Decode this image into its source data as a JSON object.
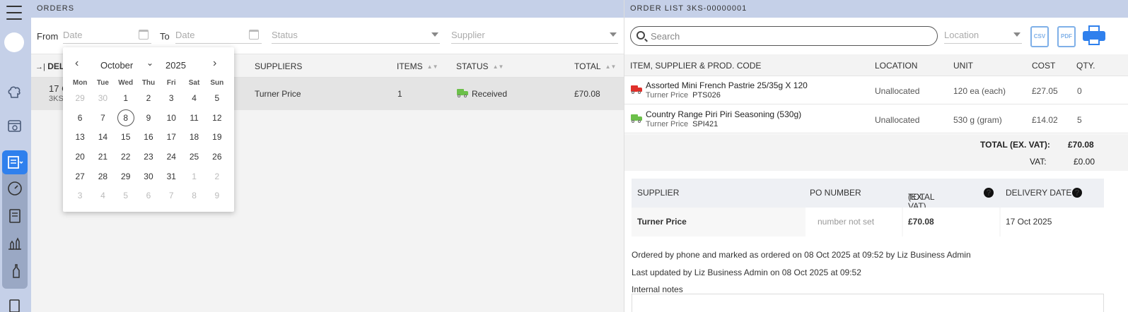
{
  "orders": {
    "title": "ORDERS",
    "filters": {
      "from_label": "From",
      "from_placeholder": "Date",
      "to_label": "To",
      "to_placeholder": "Date",
      "status_placeholder": "Status",
      "supplier_placeholder": "Supplier"
    },
    "columns": {
      "delivery": "DEL",
      "suppliers": "SUPPLIERS",
      "items": "ITEMS",
      "status": "STATUS",
      "total": "TOTAL"
    },
    "rows": [
      {
        "date": "17 C",
        "code": "3KS",
        "supplier": "Turner Price",
        "items": "1",
        "status": "Received",
        "total": "£70.08",
        "status_color": "#6cc04a"
      }
    ]
  },
  "calendar": {
    "month": "October",
    "year": "2025",
    "weekdays": [
      "Mon",
      "Tue",
      "Wed",
      "Thu",
      "Fri",
      "Sat",
      "Sun"
    ],
    "weeks": [
      [
        "29",
        "30",
        "1",
        "2",
        "3",
        "4",
        "5"
      ],
      [
        "6",
        "7",
        "8",
        "9",
        "10",
        "11",
        "12"
      ],
      [
        "13",
        "14",
        "15",
        "16",
        "17",
        "18",
        "19"
      ],
      [
        "20",
        "21",
        "22",
        "23",
        "24",
        "25",
        "26"
      ],
      [
        "27",
        "28",
        "29",
        "30",
        "31",
        "1",
        "2"
      ],
      [
        "3",
        "4",
        "5",
        "6",
        "7",
        "8",
        "9"
      ]
    ],
    "today": "8"
  },
  "detail": {
    "title": "ORDER LIST 3KS-00000001",
    "search_placeholder": "Search",
    "location_placeholder": "Location",
    "csv_label": "CSV",
    "pdf_label": "PDF",
    "columns": {
      "item": "ITEM, SUPPLIER & PROD. CODE",
      "location": "LOCATION",
      "unit": "UNIT",
      "cost": "COST",
      "qty": "QTY."
    },
    "items": [
      {
        "name": "Assorted Mini French Pastrie 25/35g X 120",
        "supplier": "Turner Price",
        "code": "PTS026",
        "location": "Unallocated",
        "unit": "120 ea (each)",
        "cost": "£27.05",
        "qty": "0",
        "truck_color": "#e0302a"
      },
      {
        "name": "Country Range Piri Piri Seasoning (530g)",
        "supplier": "Turner Price",
        "code": "SPI421",
        "location": "Unallocated",
        "unit": "530 g (gram)",
        "cost": "£14.02",
        "qty": "5",
        "truck_color": "#6cc04a"
      }
    ],
    "total_label": "TOTAL (EX. VAT):",
    "total_value": "£70.08",
    "vat_label": "VAT:",
    "vat_value": "£0.00",
    "supplier_table": {
      "col_supplier": "SUPPLIER",
      "col_po": "PO NUMBER",
      "col_total_1": "TOTAL",
      "col_total_2": "(EX. VAT)",
      "col_delivery": "DELIVERY DATE",
      "supplier": "Turner Price",
      "po": "number not set",
      "total": "£70.08",
      "delivery": "17 Oct 2025"
    },
    "ordered_note": "Ordered by phone and marked as ordered on 08 Oct 2025 at 09:52 by Liz Business Admin",
    "updated_note": "Last updated by Liz Business Admin on 08 Oct 2025 at 09:52",
    "internal_notes_label": "Internal notes"
  }
}
